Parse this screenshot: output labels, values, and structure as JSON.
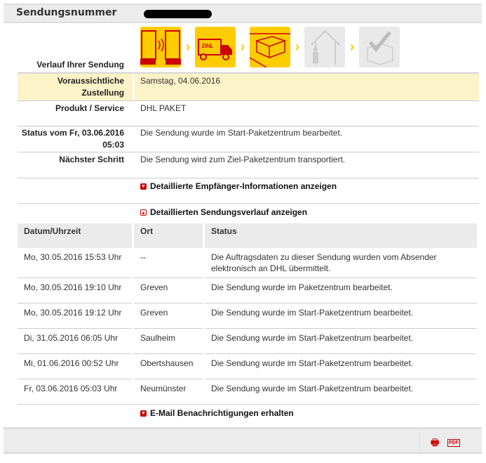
{
  "header": {
    "label": "Sendungsnummer"
  },
  "progress": {
    "label": "Verlauf Ihrer Sendung",
    "steps": [
      {
        "name": "order-data-transmitted",
        "active": true
      },
      {
        "name": "in-transit-truck",
        "active": true
      },
      {
        "name": "parcel-center",
        "active": true
      },
      {
        "name": "delivery",
        "active": false
      },
      {
        "name": "delivered",
        "active": false
      }
    ]
  },
  "details": [
    {
      "label": "Voraussichtliche Zustellung",
      "value": "Samstag, 04.06.2016"
    },
    {
      "label": "Produkt / Service",
      "value": "DHL PAKET"
    },
    {
      "label": "Status vom Fr, 03.06.2016 05:03",
      "value": "Die Sendung wurde im Start-Paketzentrum bearbeitet."
    },
    {
      "label": "Nächster Schritt",
      "value": "Die Sendung wird zum Ziel-Paketzentrum transportiert."
    }
  ],
  "links": {
    "recipient": "Detaillierte Empfänger-Informationen anzeigen",
    "history": "Detaillierten Sendungsverlauf anzeigen",
    "email": "E-Mail Benachrichtigungen erhalten"
  },
  "table": {
    "headers": [
      "Datum/Uhrzeit",
      "Ort",
      "Status"
    ],
    "rows": [
      [
        "Mo, 30.05.2016 15:53 Uhr",
        "--",
        "Die Auftragsdaten zu dieser Sendung wurden vom Absender elektronisch an DHL übermittelt."
      ],
      [
        "Mo, 30.05.2016 19:10 Uhr",
        "Greven",
        "Die Sendung wurde im Paketzentrum bearbeitet."
      ],
      [
        "Mo, 30.05.2016 19:12 Uhr",
        "Greven",
        "Die Sendung wurde im Start-Paketzentrum bearbeitet."
      ],
      [
        "Di, 31.05.2016 06:05 Uhr",
        "Saulheim",
        "Die Sendung wurde im Start-Paketzentrum bearbeitet."
      ],
      [
        "Mi, 01.06.2016 00:52 Uhr",
        "Obertshausen",
        "Die Sendung wurde im Start-Paketzentrum bearbeitet."
      ],
      [
        "Fr, 03.06.2016 05:03 Uhr",
        "Neumünster",
        "Die Sendung wurde im Start-Paketzentrum bearbeitet."
      ]
    ]
  },
  "footer": {
    "pdf_label": "PDF"
  },
  "colors": {
    "accent": "#ffcc00",
    "red": "#cc0000",
    "highlight": "#fdf3c8"
  }
}
